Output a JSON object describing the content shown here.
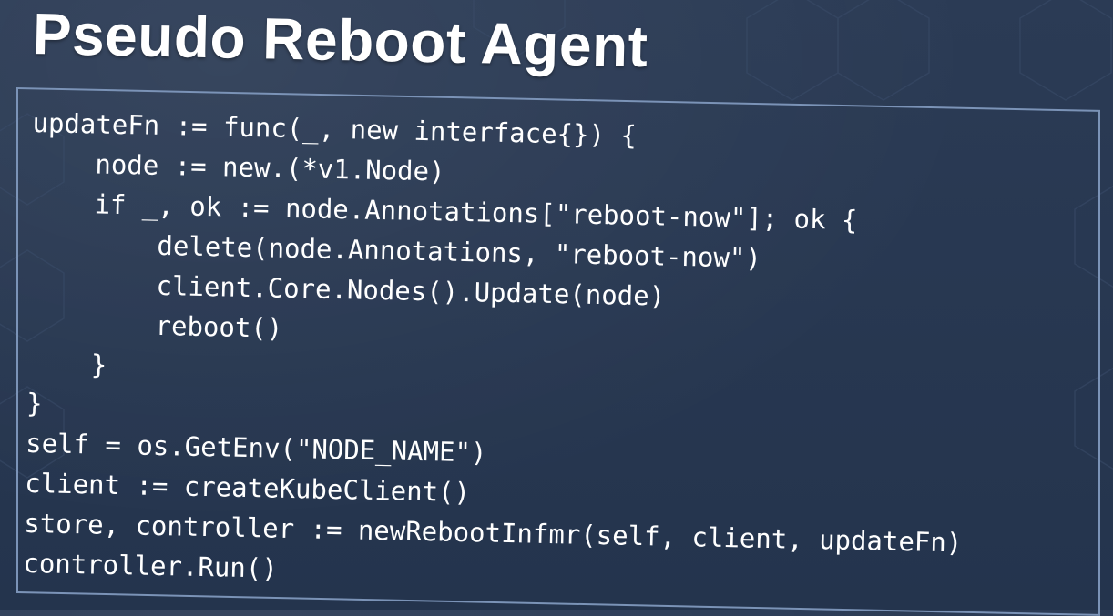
{
  "slide": {
    "title": "Pseudo Reboot Agent",
    "code_lines": [
      "updateFn := func(_, new interface{}) {",
      "    node := new.(*v1.Node)",
      "    if _, ok := node.Annotations[\"reboot-now\"]; ok {",
      "        delete(node.Annotations, \"reboot-now\")",
      "        client.Core.Nodes().Update(node)",
      "        reboot()",
      "    }",
      "}",
      "self = os.GetEnv(\"NODE_NAME\")",
      "client := createKubeClient()",
      "store, controller := newRebootInfmr(self, client, updateFn)",
      "controller.Run()"
    ]
  },
  "colors": {
    "background": "#26364f",
    "text": "#ffffff",
    "box_border": "#7b93b7"
  }
}
